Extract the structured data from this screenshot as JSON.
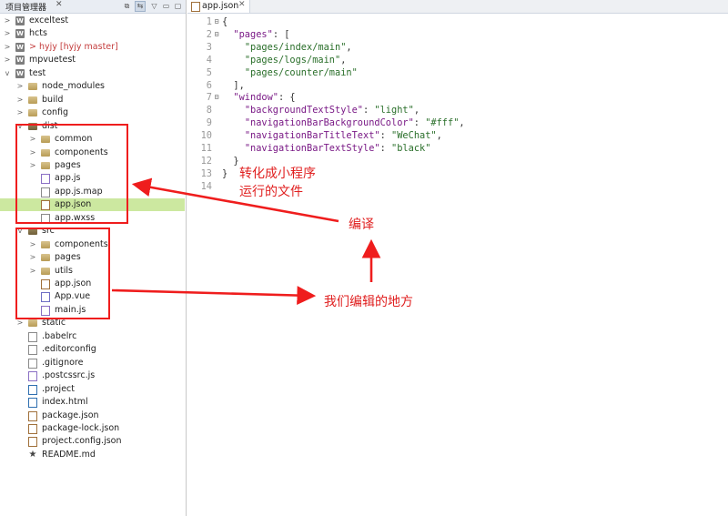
{
  "explorer": {
    "title": "项目管理器",
    "close": "✕",
    "toolbar": [
      "⧉",
      "⇆",
      "▽",
      "▭",
      "▢"
    ],
    "items": [
      {
        "label": "exceltest",
        "icon": "project-w-icon",
        "arrow": ">",
        "depth": 0
      },
      {
        "label": "hcts",
        "icon": "project-w-icon",
        "arrow": ">",
        "depth": 0
      },
      {
        "prefix": "> ",
        "label": "hyjy",
        "git": " [hyjy master]",
        "icon": "project-w-icon",
        "arrow": ">",
        "depth": 0,
        "error": true
      },
      {
        "label": "mpvuetest",
        "icon": "project-w-icon",
        "arrow": ">",
        "depth": 0
      },
      {
        "label": "test",
        "icon": "project-w-icon",
        "arrow": "v",
        "depth": 0
      },
      {
        "label": "node_modules",
        "icon": "folder-icon",
        "arrow": ">",
        "depth": 1
      },
      {
        "label": "build",
        "icon": "folder-icon",
        "arrow": ">",
        "depth": 1
      },
      {
        "label": "config",
        "icon": "folder-icon",
        "arrow": ">",
        "depth": 1
      },
      {
        "label": "dist",
        "icon": "folder-open-icon",
        "arrow": "v",
        "depth": 1
      },
      {
        "label": "common",
        "icon": "folder-icon",
        "arrow": ">",
        "depth": 2
      },
      {
        "label": "components",
        "icon": "folder-icon",
        "arrow": ">",
        "depth": 2
      },
      {
        "label": "pages",
        "icon": "folder-icon",
        "arrow": ">",
        "depth": 2
      },
      {
        "label": "app.js",
        "icon": "js-file-icon",
        "arrow": "",
        "depth": 2
      },
      {
        "label": "app.js.map",
        "icon": "file-icon",
        "arrow": "",
        "depth": 2
      },
      {
        "label": "app.json",
        "icon": "json-file-icon",
        "arrow": "",
        "depth": 2,
        "selected": true
      },
      {
        "label": "app.wxss",
        "icon": "file-icon",
        "arrow": "",
        "depth": 2
      },
      {
        "label": "src",
        "icon": "folder-open-icon",
        "arrow": "v",
        "depth": 1
      },
      {
        "label": "components",
        "icon": "folder-icon",
        "arrow": ">",
        "depth": 2
      },
      {
        "label": "pages",
        "icon": "folder-icon",
        "arrow": ">",
        "depth": 2
      },
      {
        "label": "utils",
        "icon": "folder-icon",
        "arrow": ">",
        "depth": 2
      },
      {
        "label": "app.json",
        "icon": "json-file-icon",
        "arrow": "",
        "depth": 2
      },
      {
        "label": "App.vue",
        "icon": "vue-file-icon",
        "arrow": "",
        "depth": 2
      },
      {
        "label": "main.js",
        "icon": "js-file-icon",
        "arrow": "",
        "depth": 2
      },
      {
        "label": "static",
        "icon": "folder-icon",
        "arrow": ">",
        "depth": 1
      },
      {
        "label": ".babelrc",
        "icon": "file-icon",
        "arrow": "",
        "depth": 1
      },
      {
        "label": ".editorconfig",
        "icon": "file-icon",
        "arrow": "",
        "depth": 1
      },
      {
        "label": ".gitignore",
        "icon": "file-icon",
        "arrow": "",
        "depth": 1
      },
      {
        "label": ".postcssrc.js",
        "icon": "js-file-icon",
        "arrow": "",
        "depth": 1
      },
      {
        "label": ".project",
        "icon": "html-file-icon",
        "arrow": "",
        "depth": 1
      },
      {
        "label": "index.html",
        "icon": "html-file-icon",
        "arrow": "",
        "depth": 1
      },
      {
        "label": "package.json",
        "icon": "json-file-icon",
        "arrow": "",
        "depth": 1
      },
      {
        "label": "package-lock.json",
        "icon": "json-file-icon",
        "arrow": "",
        "depth": 1
      },
      {
        "label": "project.config.json",
        "icon": "json-file-icon",
        "arrow": "",
        "depth": 1
      },
      {
        "label": "README.md",
        "icon": "star-icon",
        "arrow": "",
        "depth": 1
      }
    ]
  },
  "editor": {
    "tab_label": "app.json",
    "tab_close": "✕",
    "lines": [
      {
        "n": "1",
        "fold": "⊟",
        "parts": [
          [
            "{",
            "punc"
          ]
        ]
      },
      {
        "n": "2",
        "fold": "⊟",
        "parts": [
          [
            "  ",
            "punc"
          ],
          [
            "\"pages\"",
            "key"
          ],
          [
            ": [",
            "punc"
          ]
        ]
      },
      {
        "n": "3",
        "fold": "",
        "parts": [
          [
            "    ",
            "punc"
          ],
          [
            "\"pages/index/main\"",
            "str"
          ],
          [
            ",",
            "punc"
          ]
        ]
      },
      {
        "n": "4",
        "fold": "",
        "parts": [
          [
            "    ",
            "punc"
          ],
          [
            "\"pages/logs/main\"",
            "str"
          ],
          [
            ",",
            "punc"
          ]
        ]
      },
      {
        "n": "5",
        "fold": "",
        "parts": [
          [
            "    ",
            "punc"
          ],
          [
            "\"pages/counter/main\"",
            "str"
          ]
        ]
      },
      {
        "n": "6",
        "fold": "",
        "parts": [
          [
            "  ],",
            "punc"
          ]
        ]
      },
      {
        "n": "7",
        "fold": "⊟",
        "parts": [
          [
            "  ",
            "punc"
          ],
          [
            "\"window\"",
            "key"
          ],
          [
            ": {",
            "punc"
          ]
        ]
      },
      {
        "n": "8",
        "fold": "",
        "parts": [
          [
            "    ",
            "punc"
          ],
          [
            "\"backgroundTextStyle\"",
            "key"
          ],
          [
            ": ",
            "punc"
          ],
          [
            "\"light\"",
            "str"
          ],
          [
            ",",
            "punc"
          ]
        ]
      },
      {
        "n": "9",
        "fold": "",
        "parts": [
          [
            "    ",
            "punc"
          ],
          [
            "\"navigationBarBackgroundColor\"",
            "key"
          ],
          [
            ": ",
            "punc"
          ],
          [
            "\"#fff\"",
            "str"
          ],
          [
            ",",
            "punc"
          ]
        ]
      },
      {
        "n": "10",
        "fold": "",
        "parts": [
          [
            "    ",
            "punc"
          ],
          [
            "\"navigationBarTitleText\"",
            "key"
          ],
          [
            ": ",
            "punc"
          ],
          [
            "\"WeChat\"",
            "str"
          ],
          [
            ",",
            "punc"
          ]
        ]
      },
      {
        "n": "11",
        "fold": "",
        "parts": [
          [
            "    ",
            "punc"
          ],
          [
            "\"navigationBarTextStyle\"",
            "key"
          ],
          [
            ": ",
            "punc"
          ],
          [
            "\"black\"",
            "str"
          ]
        ]
      },
      {
        "n": "12",
        "fold": "",
        "parts": [
          [
            "  }",
            "punc"
          ]
        ]
      },
      {
        "n": "13",
        "fold": "",
        "parts": [
          [
            "}",
            "punc"
          ]
        ]
      },
      {
        "n": "14",
        "fold": "",
        "parts": []
      }
    ]
  },
  "annotations": {
    "dist_note_1": "转化成小程序",
    "dist_note_2": "运行的文件",
    "compile_note": "编译",
    "src_note": "我们编辑的地方"
  },
  "colors": {
    "annotation_red": "#ef1d1d",
    "selection_green": "#cce8a0",
    "json_key": "#7a1a86",
    "json_string": "#2a6f2a"
  }
}
